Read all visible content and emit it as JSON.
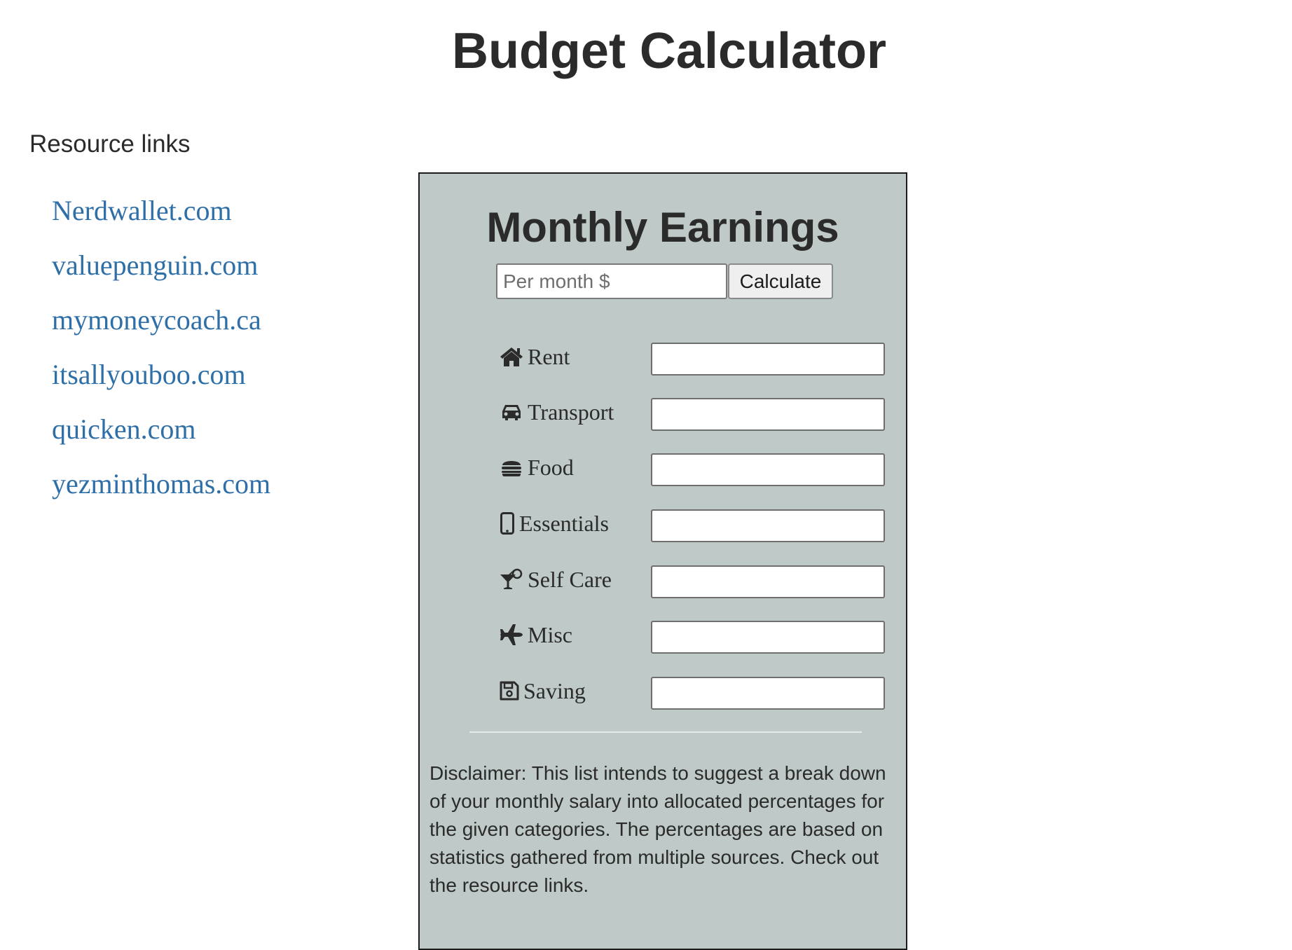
{
  "page": {
    "title": "Budget Calculator"
  },
  "resources": {
    "heading": "Resource links",
    "links": [
      "Nerdwallet.com",
      "valuepenguin.com",
      "mymoneycoach.ca",
      "itsallyouboo.com",
      "quicken.com",
      "yezminthomas.com"
    ],
    "link_color": "#2f6fa8"
  },
  "card": {
    "title": "Monthly Earnings",
    "earnings_placeholder": "Per month $",
    "earnings_value": "",
    "calculate_label": "Calculate",
    "background_color": "#bfc9c7",
    "categories": [
      {
        "icon": "home-icon",
        "label": "Rent",
        "value": ""
      },
      {
        "icon": "car-icon",
        "label": "Transport",
        "value": ""
      },
      {
        "icon": "hamburger-icon",
        "label": "Food",
        "value": ""
      },
      {
        "icon": "mobile-phone-icon",
        "label": "Essentials",
        "value": ""
      },
      {
        "icon": "cocktail-icon",
        "label": "Self Care",
        "value": ""
      },
      {
        "icon": "airplane-icon",
        "label": "Misc",
        "value": ""
      },
      {
        "icon": "floppy-disk-icon",
        "label": "Saving",
        "value": ""
      }
    ],
    "disclaimer": "Disclaimer: This list intends to suggest a break down of your monthly salary into allocated percentages for the given categories. The percentages are based on statistics gathered from multiple sources. Check out the resource links."
  }
}
